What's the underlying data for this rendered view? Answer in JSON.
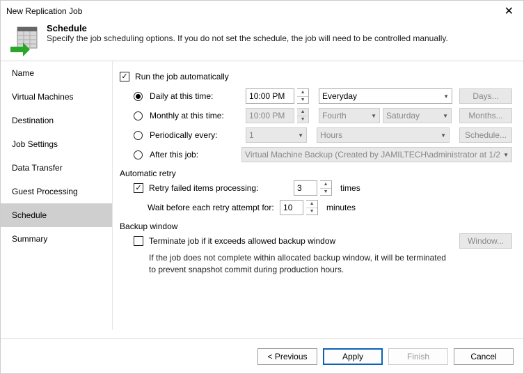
{
  "window": {
    "title": "New Replication Job"
  },
  "header": {
    "heading": "Schedule",
    "subheading": "Specify the job scheduling options. If you do not set the schedule, the job will need to be controlled manually."
  },
  "sidebar": {
    "items": [
      {
        "label": "Name"
      },
      {
        "label": "Virtual Machines"
      },
      {
        "label": "Destination"
      },
      {
        "label": "Job Settings"
      },
      {
        "label": "Data Transfer"
      },
      {
        "label": "Guest Processing"
      },
      {
        "label": "Schedule"
      },
      {
        "label": "Summary"
      }
    ]
  },
  "schedule": {
    "run_auto_label": "Run the job automatically",
    "daily_label": "Daily at this time:",
    "daily_time": "10:00 PM",
    "daily_freq": "Everyday",
    "days_btn": "Days...",
    "monthly_label": "Monthly at this time:",
    "monthly_time": "10:00 PM",
    "monthly_ord": "Fourth",
    "monthly_day": "Saturday",
    "months_btn": "Months...",
    "periodic_label": "Periodically every:",
    "periodic_n": "1",
    "periodic_unit": "Hours",
    "schedule_btn": "Schedule...",
    "after_label": "After this job:",
    "after_job": "Virtual Machine Backup (Created by JAMILTECH\\administrator at 1/2"
  },
  "retry": {
    "group_label": "Automatic retry",
    "retry_label": "Retry failed items processing:",
    "retry_count": "3",
    "times_label": "times",
    "wait_label": "Wait before each retry attempt for:",
    "wait_minutes": "10",
    "minutes_label": "minutes"
  },
  "backupwin": {
    "group_label": "Backup window",
    "terminate_label": "Terminate job if it exceeds allowed backup window",
    "window_btn": "Window...",
    "hint": "If the job does not complete within allocated backup window, it will be terminated to prevent snapshot commit during production hours."
  },
  "footer": {
    "previous": "< Previous",
    "apply": "Apply",
    "finish": "Finish",
    "cancel": "Cancel"
  }
}
